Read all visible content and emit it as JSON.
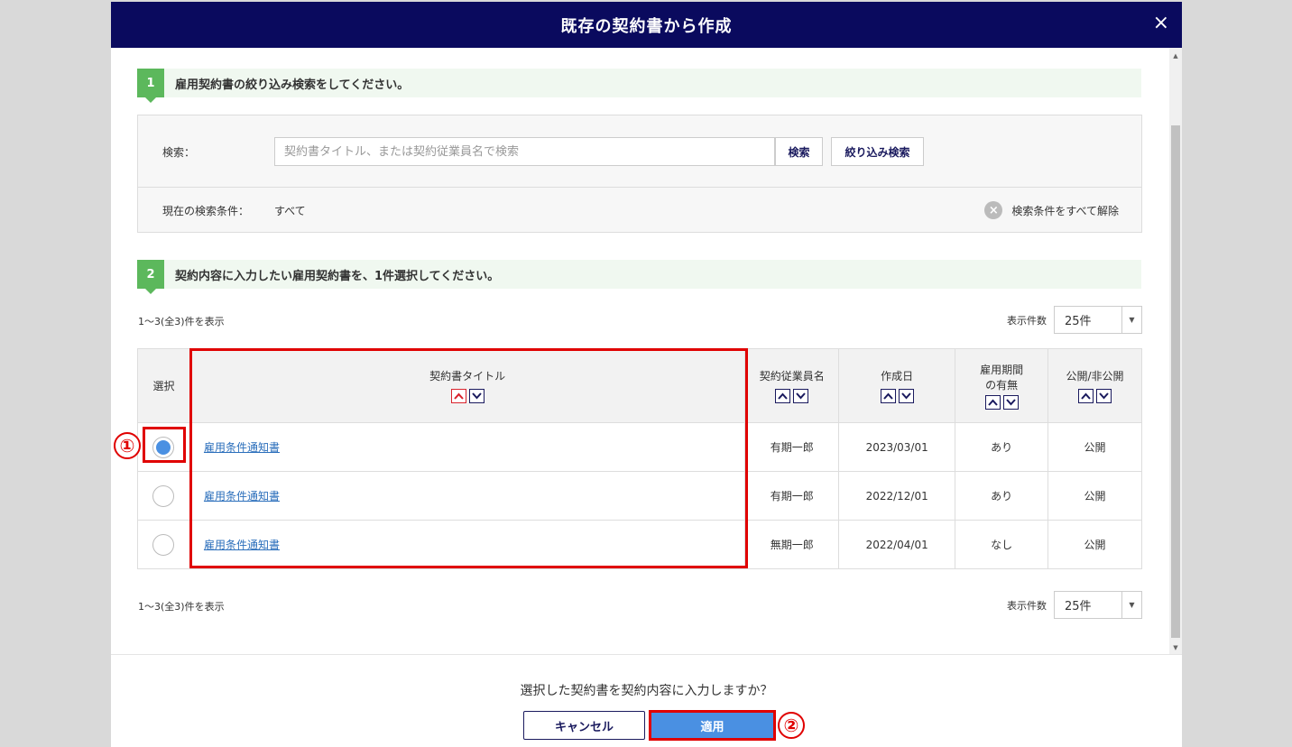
{
  "modal": {
    "title": "既存の契約書から作成",
    "close_icon": "×"
  },
  "step1": {
    "number": "1",
    "text": "雇用契約書の絞り込み検索をしてください。"
  },
  "search": {
    "label": "検索：",
    "placeholder": "契約書タイトル、または契約従業員名で検索",
    "search_button": "検索",
    "filter_button": "絞り込み検索",
    "current_label": "現在の検索条件：",
    "current_value": "すべて",
    "clear_icon": "×",
    "clear_text": "検索条件をすべて解除"
  },
  "step2": {
    "number": "2",
    "text": "契約内容に入力したい雇用契約書を、1件選択してください。"
  },
  "result_count_top": "1〜3(全3)件を表示",
  "result_count_bottom": "1〜3(全3)件を表示",
  "per_page": {
    "label": "表示件数",
    "value": "25件"
  },
  "table": {
    "headers": {
      "select": "選択",
      "title": "契約書タイトル",
      "employee": "契約従業員名",
      "created": "作成日",
      "period_line1": "雇用期間",
      "period_line2": "の有無",
      "visibility": "公開/非公開"
    },
    "rows": [
      {
        "selected": true,
        "title": "雇用条件通知書",
        "employee": "有期一郎",
        "created": "2023/03/01",
        "period": "あり",
        "visibility": "公開"
      },
      {
        "selected": false,
        "title": "雇用条件通知書",
        "employee": "有期一郎",
        "created": "2022/12/01",
        "period": "あり",
        "visibility": "公開"
      },
      {
        "selected": false,
        "title": "雇用条件通知書",
        "employee": "無期一郎",
        "created": "2022/04/01",
        "period": "なし",
        "visibility": "公開"
      }
    ]
  },
  "annotations": {
    "one": "①",
    "two": "②"
  },
  "footer": {
    "question": "選択した契約書を契約内容に入力しますか？",
    "cancel": "キャンセル",
    "apply": "適用"
  },
  "colors": {
    "header_bg": "#0a0a5e",
    "step_badge": "#5cb85c",
    "accent": "#4a90e2",
    "highlight": "#e00000",
    "sort_active": "#d9232d"
  }
}
